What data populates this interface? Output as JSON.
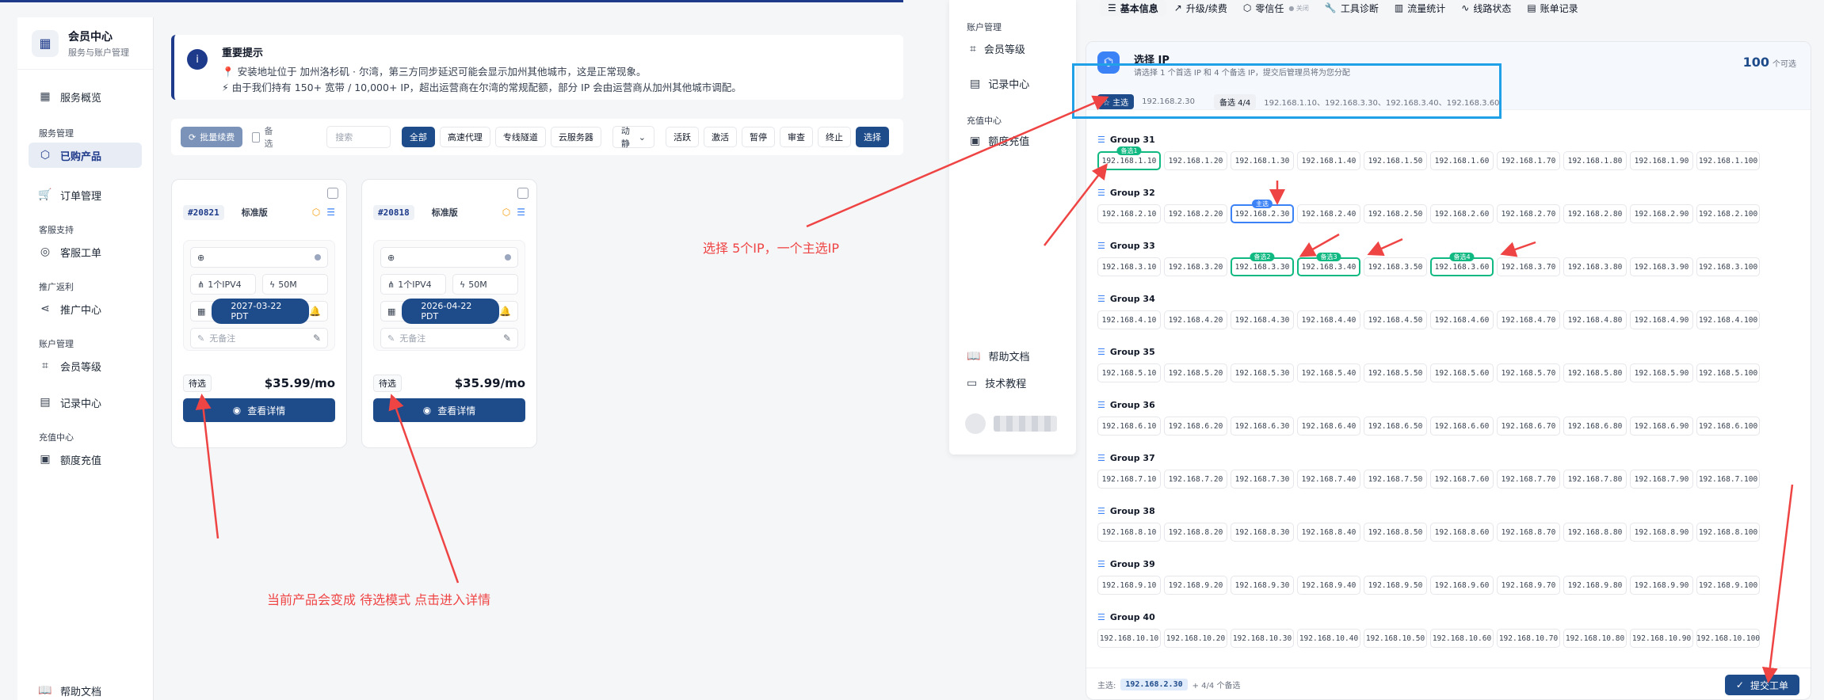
{
  "left": {
    "brand": {
      "title": "会员中心",
      "subtitle": "服务与账户管理"
    },
    "nav": {
      "overview": "服务概览",
      "group_service": "服务管理",
      "purchased": "已购产品",
      "orders": "订单管理",
      "group_support": "客服支持",
      "tickets": "客服工单",
      "group_promo": "推广返利",
      "promo": "推广中心",
      "group_account": "账户管理",
      "level": "会员等级",
      "records": "记录中心",
      "group_recharge": "充值中心",
      "recharge": "额度充值",
      "help": "帮助文档"
    },
    "notice": {
      "title": "重要提示",
      "line1_icon": "📍",
      "line1": "安装地址位于 加州洛杉矶 · 尔湾，第三方同步延迟可能会显示加州其他城市，这是正常现象。",
      "line2_icon": "⚡",
      "line2": "由于我们持有 150+ 宽带 / 10,000+ IP，超出运营商在尔湾的常规配额，部分 IP 会由运营商从加州其他城市调配。"
    },
    "toolbar": {
      "batch_renew": "批量续费",
      "backup": "备选",
      "search_placeholder": "搜索",
      "filters": [
        "全部",
        "高速代理",
        "专线隧道",
        "云服务器"
      ],
      "select": "动静",
      "statuses": [
        "活跃",
        "激活",
        "暂停",
        "审查",
        "终止",
        "选择"
      ]
    },
    "cards": [
      {
        "id": "#20821",
        "plan": "标准版",
        "ip": "1个IPV4",
        "bandwidth": "50M",
        "date": "2027-03-22 PDT",
        "note": "无备注",
        "status": "待选",
        "price": "$35.99/mo",
        "detail": "查看详情"
      },
      {
        "id": "#20818",
        "plan": "标准版",
        "ip": "1个IPV4",
        "bandwidth": "50M",
        "date": "2026-04-22 PDT",
        "note": "无备注",
        "status": "待选",
        "price": "$35.99/mo",
        "detail": "查看详情"
      }
    ],
    "annotation": "当前产品会变成 待选模式 点击进入详情"
  },
  "right": {
    "sidebar": {
      "group_account": "账户管理",
      "level": "会员等级",
      "records": "记录中心",
      "group_recharge": "充值中心",
      "recharge": "额度充值",
      "help": "帮助文档",
      "tutorial": "技术教程"
    },
    "tabs": [
      {
        "label": "基本信息",
        "icon": "server-icon"
      },
      {
        "label": "升级/续费",
        "icon": "trend-icon"
      },
      {
        "label": "零信任",
        "icon": "shield-icon",
        "small": "● 关闭"
      },
      {
        "label": "工具诊断",
        "icon": "wrench-icon"
      },
      {
        "label": "流量统计",
        "icon": "bar-chart-icon"
      },
      {
        "label": "线路状态",
        "icon": "pulse-icon"
      },
      {
        "label": "账单记录",
        "icon": "receipt-icon"
      }
    ],
    "panel": {
      "title": "选择 IP",
      "subtitle": "请选择 1 个首选 IP 和 4 个备选 IP，提交后管理员将为您分配",
      "count": "100",
      "count_label": "个可选",
      "primary_label": "主选",
      "primary_ip": "192.168.2.30",
      "backup_label": "备选 4/4",
      "backup_ips": "192.168.1.10、192.168.3.30、192.168.3.40、192.168.3.60",
      "footer_label": "主选:",
      "footer_ip": "192.168.2.30",
      "footer_backup": "+ 4/4 个备选",
      "submit": "提交工单"
    },
    "groups": [
      {
        "name": "Group 31",
        "ips": [
          "192.168.1.10",
          "192.168.1.20",
          "192.168.1.30",
          "192.168.1.40",
          "192.168.1.50",
          "192.168.1.60",
          "192.168.1.70",
          "192.168.1.80",
          "192.168.1.90",
          "192.168.1.100"
        ]
      },
      {
        "name": "Group 32",
        "ips": [
          "192.168.2.10",
          "192.168.2.20",
          "192.168.2.30",
          "192.168.2.40",
          "192.168.2.50",
          "192.168.2.60",
          "192.168.2.70",
          "192.168.2.80",
          "192.168.2.90",
          "192.168.2.100"
        ]
      },
      {
        "name": "Group 33",
        "ips": [
          "192.168.3.10",
          "192.168.3.20",
          "192.168.3.30",
          "192.168.3.40",
          "192.168.3.50",
          "192.168.3.60",
          "192.168.3.70",
          "192.168.3.80",
          "192.168.3.90",
          "192.168.3.100"
        ]
      },
      {
        "name": "Group 34",
        "ips": [
          "192.168.4.10",
          "192.168.4.20",
          "192.168.4.30",
          "192.168.4.40",
          "192.168.4.50",
          "192.168.4.60",
          "192.168.4.70",
          "192.168.4.80",
          "192.168.4.90",
          "192.168.4.100"
        ]
      },
      {
        "name": "Group 35",
        "ips": [
          "192.168.5.10",
          "192.168.5.20",
          "192.168.5.30",
          "192.168.5.40",
          "192.168.5.50",
          "192.168.5.60",
          "192.168.5.70",
          "192.168.5.80",
          "192.168.5.90",
          "192.168.5.100"
        ]
      },
      {
        "name": "Group 36",
        "ips": [
          "192.168.6.10",
          "192.168.6.20",
          "192.168.6.30",
          "192.168.6.40",
          "192.168.6.50",
          "192.168.6.60",
          "192.168.6.70",
          "192.168.6.80",
          "192.168.6.90",
          "192.168.6.100"
        ]
      },
      {
        "name": "Group 37",
        "ips": [
          "192.168.7.10",
          "192.168.7.20",
          "192.168.7.30",
          "192.168.7.40",
          "192.168.7.50",
          "192.168.7.60",
          "192.168.7.70",
          "192.168.7.80",
          "192.168.7.90",
          "192.168.7.100"
        ]
      },
      {
        "name": "Group 38",
        "ips": [
          "192.168.8.10",
          "192.168.8.20",
          "192.168.8.30",
          "192.168.8.40",
          "192.168.8.50",
          "192.168.8.60",
          "192.168.8.70",
          "192.168.8.80",
          "192.168.8.90",
          "192.168.8.100"
        ]
      },
      {
        "name": "Group 39",
        "ips": [
          "192.168.9.10",
          "192.168.9.20",
          "192.168.9.30",
          "192.168.9.40",
          "192.168.9.50",
          "192.168.9.60",
          "192.168.9.70",
          "192.168.9.80",
          "192.168.9.90",
          "192.168.9.100"
        ]
      },
      {
        "name": "Group 40",
        "ips": [
          "192.168.10.10",
          "192.168.10.20",
          "192.168.10.30",
          "192.168.10.40",
          "192.168.10.50",
          "192.168.10.60",
          "192.168.10.70",
          "192.168.10.80",
          "192.168.10.90",
          "192.168.10.100"
        ]
      }
    ],
    "selection": {
      "192.168.1.10": "备选1",
      "192.168.2.30": "主选",
      "192.168.3.30": "备选2",
      "192.168.3.40": "备选3",
      "192.168.3.60": "备选4"
    },
    "annotation": "选择 5个IP，一个主选IP"
  },
  "colors": {
    "accent": "#1e4b8a",
    "annotation": "#ef4444",
    "highlight_box": "#20a0e6",
    "backup": "#10b981",
    "primary": "#3b82f6"
  }
}
